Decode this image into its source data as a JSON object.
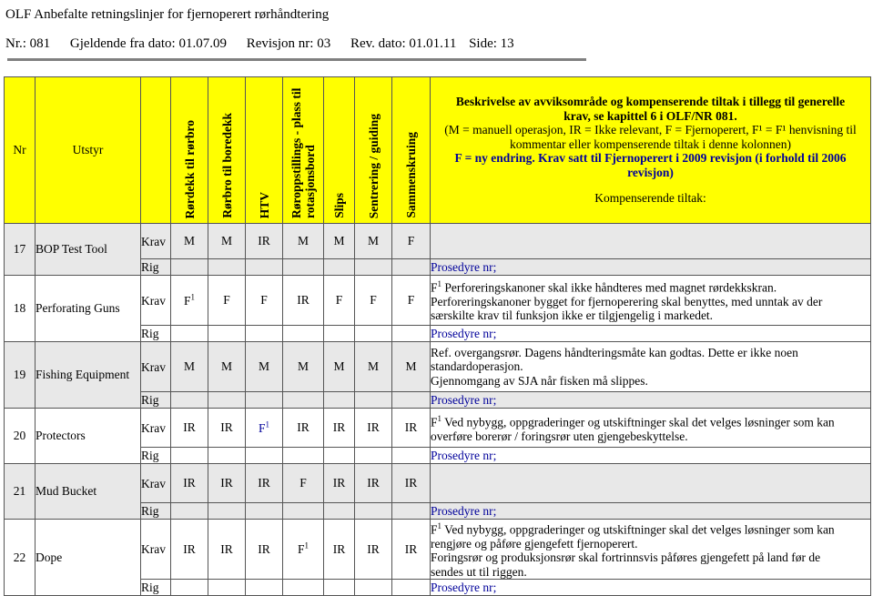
{
  "document": {
    "title": "OLF Anbefalte retningslinjer for fjernoperert rørhåndtering",
    "meta": {
      "nr": "Nr.: 081",
      "valid_from": "Gjeldende fra dato: 01.07.09",
      "revision": "Revisjon nr: 03",
      "rev_date": "Rev. dato: 01.01.11",
      "page": "Side: 13"
    }
  },
  "table": {
    "headers": {
      "nr": "Nr",
      "utstyr": "Utstyr",
      "krav_rig": "",
      "columns": [
        "Rørdekk til rørbro",
        "Rørbro til boredekk",
        "HTV",
        "Røroppstillings - plass til rotasjonsbord",
        "Slips",
        "Sentrering / guiding",
        "Sammenskruing"
      ],
      "description": {
        "line1": "Beskrivelse av avviksområde og kompenserende tiltak i tillegg til generelle",
        "line2": "krav, se kapittel 6 i OLF/NR 081.",
        "line3": "(M = manuell operasjon, IR = Ikke relevant, F = Fjernoperert, F¹ = F¹ henvisning til",
        "line4": "kommentar eller kompenserende tiltak i denne kolonnen)",
        "line5": "F = ny endring. Krav satt til Fjernoperert i 2009 revisjon (i forhold til 2006",
        "line6": "revisjon)",
        "line7": "Kompenserende tiltak:"
      }
    },
    "row_label_krav": "Krav",
    "row_label_rig": "Rig",
    "procedure_label": "Prosedyre nr;",
    "rows": [
      {
        "nr": "17",
        "utstyr": "BOP Test Tool",
        "values": [
          "M",
          "M",
          "IR",
          "M",
          "M",
          "M",
          "F"
        ],
        "value_colors": [
          "",
          "",
          "",
          "",
          "",
          "",
          ""
        ],
        "description": []
      },
      {
        "nr": "18",
        "utstyr": "Perforating Guns",
        "values": [
          "F¹",
          "F",
          "F",
          "IR",
          "F",
          "F",
          "F"
        ],
        "value_colors": [
          "",
          "",
          "",
          "",
          "",
          "",
          ""
        ],
        "description": [
          "F¹ Perforeringskanoner skal ikke håndteres med magnet rørdekkskran.",
          "Perforeringskanoner bygget for fjernoperering skal benyttes, med unntak av der",
          "særskilte krav til funksjon ikke er tilgjengelig i markedet."
        ]
      },
      {
        "nr": "19",
        "utstyr": "Fishing Equipment",
        "values": [
          "M",
          "M",
          "M",
          "M",
          "M",
          "M",
          "M"
        ],
        "value_colors": [
          "",
          "",
          "",
          "",
          "",
          "",
          ""
        ],
        "description": [
          "Ref. overgangsrør. Dagens håndteringsmåte kan godtas. Dette er ikke noen",
          "standardoperasjon.",
          "Gjennomgang av SJA når fisken må slippes."
        ]
      },
      {
        "nr": "20",
        "utstyr": "Protectors",
        "values": [
          "IR",
          "IR",
          "F¹",
          "IR",
          "IR",
          "IR",
          "IR"
        ],
        "value_colors": [
          "",
          "",
          "blue",
          "",
          "",
          "",
          ""
        ],
        "description": [
          "F¹ Ved nybygg, oppgraderinger og utskiftninger skal det velges løsninger som kan",
          "overføre borerør / foringsrør uten gjengebeskyttelse."
        ]
      },
      {
        "nr": "21",
        "utstyr": "Mud Bucket",
        "values": [
          "IR",
          "IR",
          "IR",
          "F",
          "IR",
          "IR",
          "IR"
        ],
        "value_colors": [
          "",
          "",
          "",
          "",
          "",
          "",
          ""
        ],
        "description": []
      },
      {
        "nr": "22",
        "utstyr": "Dope",
        "values": [
          "IR",
          "IR",
          "IR",
          "F¹",
          "IR",
          "IR",
          "IR"
        ],
        "value_colors": [
          "",
          "",
          "",
          "",
          "",
          "",
          ""
        ],
        "description": [
          "F¹ Ved nybygg, oppgraderinger og utskiftninger skal det velges løsninger som kan",
          "rengjøre og påføre gjengefett fjernoperert.",
          "Foringsrør og produksjonsrør skal fortrinnsvis påføres gjengefett på land før de",
          "sendes ut til riggen."
        ]
      }
    ]
  },
  "colors": {
    "header_yellow": "#ffff00",
    "accent_blue": "#00009a",
    "row_shade": "#e8e8e8",
    "rule_gray": "#808080"
  }
}
